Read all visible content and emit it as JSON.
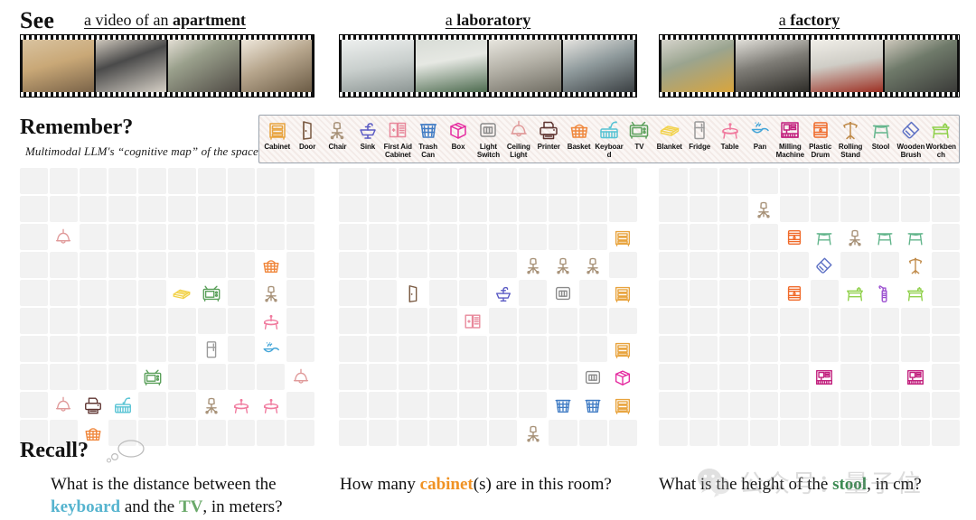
{
  "see": {
    "label": "See",
    "panels": [
      {
        "article": "a video of an ",
        "noun": "apartment",
        "frames": [
          "apartment-table-frame",
          "apartment-tv-frame",
          "apartment-kitchen-frame",
          "apartment-corner-frame"
        ]
      },
      {
        "article": "a ",
        "noun": "laboratory",
        "frames": [
          "lab-sink-frame",
          "lab-door-frame",
          "lab-bench-frame",
          "lab-chair-frame"
        ]
      },
      {
        "article": "a ",
        "noun": "factory",
        "frames": [
          "factory-chairs-frame",
          "factory-machine-frame",
          "factory-cnc-frame",
          "factory-workbench-frame"
        ]
      }
    ]
  },
  "remember": {
    "label": "Remember?",
    "subtitle": "Multimodal LLM's “cognitive map” of the space"
  },
  "legend": [
    {
      "id": "cabinet",
      "label": "Cabinet",
      "color": "#E8A33D"
    },
    {
      "id": "door",
      "label": "Door",
      "color": "#7B5B43"
    },
    {
      "id": "chair",
      "label": "Chair",
      "color": "#A79177"
    },
    {
      "id": "sink",
      "label": "Sink",
      "color": "#5B5BC4"
    },
    {
      "id": "first-aid-cabinet",
      "label": "First Aid Cabinet",
      "color": "#E8889B"
    },
    {
      "id": "trash-can",
      "label": "Trash Can",
      "color": "#3F7BC4"
    },
    {
      "id": "box",
      "label": "Box",
      "color": "#E52BA0"
    },
    {
      "id": "light-switch",
      "label": "Light Switch",
      "color": "#8A8A8A"
    },
    {
      "id": "ceiling-light",
      "label": "Ceiling Light",
      "color": "#E09A9A"
    },
    {
      "id": "printer",
      "label": "Printer",
      "color": "#5E3430"
    },
    {
      "id": "basket",
      "label": "Basket",
      "color": "#F0873C"
    },
    {
      "id": "keyboard",
      "label": "Keyboard",
      "color": "#57C3D4"
    },
    {
      "id": "tv",
      "label": "TV",
      "color": "#5BA05B"
    },
    {
      "id": "blanket",
      "label": "Blanket",
      "color": "#F2D24B"
    },
    {
      "id": "fridge",
      "label": "Fridge",
      "color": "#9A9A9A"
    },
    {
      "id": "table",
      "label": "Table",
      "color": "#F07A9E"
    },
    {
      "id": "pan",
      "label": "Pan",
      "color": "#43A5D8"
    },
    {
      "id": "milling-machine",
      "label": "Milling Machine",
      "color": "#C2217E"
    },
    {
      "id": "plastic-drum",
      "label": "Plastic Drum",
      "color": "#F06A2A"
    },
    {
      "id": "rolling-stand",
      "label": "Rolling Stand",
      "color": "#C08B4A"
    },
    {
      "id": "stool",
      "label": "Stool",
      "color": "#63B58C"
    },
    {
      "id": "wooden-brush",
      "label": "Wooden Brush",
      "color": "#5B6FC4"
    },
    {
      "id": "workbench",
      "label": "Workbench",
      "color": "#8FD04A"
    },
    {
      "id": "spray-bottle",
      "label": "Spray Bottle",
      "color": "#9B4FD0"
    }
  ],
  "maps": [
    {
      "name": "apartment-map",
      "cols": 10,
      "rows": 10,
      "items": [
        {
          "row": 2,
          "col": 1,
          "icon": "ceiling-light"
        },
        {
          "row": 3,
          "col": 8,
          "icon": "basket"
        },
        {
          "row": 4,
          "col": 5,
          "icon": "blanket"
        },
        {
          "row": 4,
          "col": 6,
          "icon": "tv"
        },
        {
          "row": 4,
          "col": 8,
          "icon": "chair"
        },
        {
          "row": 5,
          "col": 8,
          "icon": "table"
        },
        {
          "row": 6,
          "col": 6,
          "icon": "fridge"
        },
        {
          "row": 6,
          "col": 8,
          "icon": "pan"
        },
        {
          "row": 7,
          "col": 4,
          "icon": "tv"
        },
        {
          "row": 7,
          "col": 9,
          "icon": "ceiling-light"
        },
        {
          "row": 8,
          "col": 1,
          "icon": "ceiling-light"
        },
        {
          "row": 8,
          "col": 2,
          "icon": "printer"
        },
        {
          "row": 8,
          "col": 3,
          "icon": "keyboard"
        },
        {
          "row": 8,
          "col": 6,
          "icon": "chair"
        },
        {
          "row": 8,
          "col": 7,
          "icon": "table"
        },
        {
          "row": 8,
          "col": 8,
          "icon": "table"
        },
        {
          "row": 9,
          "col": 2,
          "icon": "basket"
        }
      ]
    },
    {
      "name": "laboratory-map",
      "cols": 10,
      "rows": 10,
      "items": [
        {
          "row": 2,
          "col": 9,
          "icon": "cabinet"
        },
        {
          "row": 3,
          "col": 6,
          "icon": "chair"
        },
        {
          "row": 3,
          "col": 7,
          "icon": "chair"
        },
        {
          "row": 3,
          "col": 8,
          "icon": "chair"
        },
        {
          "row": 4,
          "col": 2,
          "icon": "door"
        },
        {
          "row": 4,
          "col": 5,
          "icon": "sink"
        },
        {
          "row": 4,
          "col": 7,
          "icon": "light-switch"
        },
        {
          "row": 4,
          "col": 9,
          "icon": "cabinet"
        },
        {
          "row": 5,
          "col": 4,
          "icon": "first-aid-cabinet"
        },
        {
          "row": 6,
          "col": 9,
          "icon": "cabinet"
        },
        {
          "row": 7,
          "col": 8,
          "icon": "light-switch"
        },
        {
          "row": 7,
          "col": 9,
          "icon": "box"
        },
        {
          "row": 8,
          "col": 7,
          "icon": "trash-can"
        },
        {
          "row": 8,
          "col": 8,
          "icon": "trash-can"
        },
        {
          "row": 8,
          "col": 9,
          "icon": "cabinet"
        },
        {
          "row": 9,
          "col": 6,
          "icon": "chair"
        }
      ]
    },
    {
      "name": "factory-map",
      "cols": 10,
      "rows": 10,
      "items": [
        {
          "row": 1,
          "col": 3,
          "icon": "chair"
        },
        {
          "row": 2,
          "col": 4,
          "icon": "plastic-drum"
        },
        {
          "row": 2,
          "col": 5,
          "icon": "stool"
        },
        {
          "row": 2,
          "col": 6,
          "icon": "chair"
        },
        {
          "row": 2,
          "col": 7,
          "icon": "stool"
        },
        {
          "row": 2,
          "col": 8,
          "icon": "stool"
        },
        {
          "row": 3,
          "col": 5,
          "icon": "wooden-brush"
        },
        {
          "row": 3,
          "col": 8,
          "icon": "rolling-stand"
        },
        {
          "row": 4,
          "col": 4,
          "icon": "plastic-drum"
        },
        {
          "row": 4,
          "col": 6,
          "icon": "workbench"
        },
        {
          "row": 4,
          "col": 7,
          "icon": "spray-bottle"
        },
        {
          "row": 4,
          "col": 8,
          "icon": "workbench"
        },
        {
          "row": 7,
          "col": 5,
          "icon": "milling-machine"
        },
        {
          "row": 7,
          "col": 8,
          "icon": "milling-machine"
        }
      ]
    }
  ],
  "recall": {
    "label": "Recall?",
    "questions": [
      {
        "id": "q-distance",
        "pre": "What is the distance between the ",
        "kw1": "keyboard",
        "mid": " and the ",
        "kw2": "TV",
        "post": ", in meters?"
      },
      {
        "id": "q-count",
        "pre": "How many ",
        "kw1": "cabinet",
        "mid": "(s) are in this room?",
        "kw2": "",
        "post": ""
      },
      {
        "id": "q-height",
        "pre": "What is the height of the ",
        "kw1": "stool",
        "mid": ", in cm?",
        "kw2": "",
        "post": ""
      }
    ]
  },
  "watermark": {
    "text": "公众号：量子位"
  }
}
